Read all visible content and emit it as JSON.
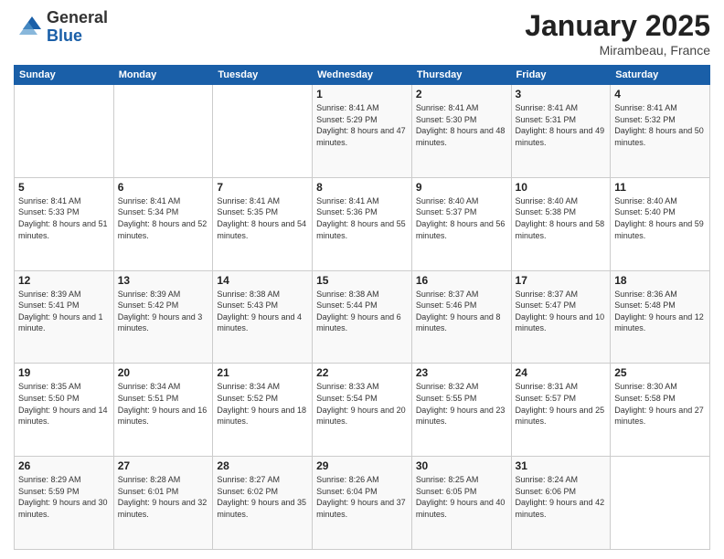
{
  "logo": {
    "general": "General",
    "blue": "Blue"
  },
  "header": {
    "month_year": "January 2025",
    "location": "Mirambeau, France"
  },
  "weekdays": [
    "Sunday",
    "Monday",
    "Tuesday",
    "Wednesday",
    "Thursday",
    "Friday",
    "Saturday"
  ],
  "weeks": [
    [
      {
        "day": "",
        "info": ""
      },
      {
        "day": "",
        "info": ""
      },
      {
        "day": "",
        "info": ""
      },
      {
        "day": "1",
        "info": "Sunrise: 8:41 AM\nSunset: 5:29 PM\nDaylight: 8 hours and 47 minutes."
      },
      {
        "day": "2",
        "info": "Sunrise: 8:41 AM\nSunset: 5:30 PM\nDaylight: 8 hours and 48 minutes."
      },
      {
        "day": "3",
        "info": "Sunrise: 8:41 AM\nSunset: 5:31 PM\nDaylight: 8 hours and 49 minutes."
      },
      {
        "day": "4",
        "info": "Sunrise: 8:41 AM\nSunset: 5:32 PM\nDaylight: 8 hours and 50 minutes."
      }
    ],
    [
      {
        "day": "5",
        "info": "Sunrise: 8:41 AM\nSunset: 5:33 PM\nDaylight: 8 hours and 51 minutes."
      },
      {
        "day": "6",
        "info": "Sunrise: 8:41 AM\nSunset: 5:34 PM\nDaylight: 8 hours and 52 minutes."
      },
      {
        "day": "7",
        "info": "Sunrise: 8:41 AM\nSunset: 5:35 PM\nDaylight: 8 hours and 54 minutes."
      },
      {
        "day": "8",
        "info": "Sunrise: 8:41 AM\nSunset: 5:36 PM\nDaylight: 8 hours and 55 minutes."
      },
      {
        "day": "9",
        "info": "Sunrise: 8:40 AM\nSunset: 5:37 PM\nDaylight: 8 hours and 56 minutes."
      },
      {
        "day": "10",
        "info": "Sunrise: 8:40 AM\nSunset: 5:38 PM\nDaylight: 8 hours and 58 minutes."
      },
      {
        "day": "11",
        "info": "Sunrise: 8:40 AM\nSunset: 5:40 PM\nDaylight: 8 hours and 59 minutes."
      }
    ],
    [
      {
        "day": "12",
        "info": "Sunrise: 8:39 AM\nSunset: 5:41 PM\nDaylight: 9 hours and 1 minute."
      },
      {
        "day": "13",
        "info": "Sunrise: 8:39 AM\nSunset: 5:42 PM\nDaylight: 9 hours and 3 minutes."
      },
      {
        "day": "14",
        "info": "Sunrise: 8:38 AM\nSunset: 5:43 PM\nDaylight: 9 hours and 4 minutes."
      },
      {
        "day": "15",
        "info": "Sunrise: 8:38 AM\nSunset: 5:44 PM\nDaylight: 9 hours and 6 minutes."
      },
      {
        "day": "16",
        "info": "Sunrise: 8:37 AM\nSunset: 5:46 PM\nDaylight: 9 hours and 8 minutes."
      },
      {
        "day": "17",
        "info": "Sunrise: 8:37 AM\nSunset: 5:47 PM\nDaylight: 9 hours and 10 minutes."
      },
      {
        "day": "18",
        "info": "Sunrise: 8:36 AM\nSunset: 5:48 PM\nDaylight: 9 hours and 12 minutes."
      }
    ],
    [
      {
        "day": "19",
        "info": "Sunrise: 8:35 AM\nSunset: 5:50 PM\nDaylight: 9 hours and 14 minutes."
      },
      {
        "day": "20",
        "info": "Sunrise: 8:34 AM\nSunset: 5:51 PM\nDaylight: 9 hours and 16 minutes."
      },
      {
        "day": "21",
        "info": "Sunrise: 8:34 AM\nSunset: 5:52 PM\nDaylight: 9 hours and 18 minutes."
      },
      {
        "day": "22",
        "info": "Sunrise: 8:33 AM\nSunset: 5:54 PM\nDaylight: 9 hours and 20 minutes."
      },
      {
        "day": "23",
        "info": "Sunrise: 8:32 AM\nSunset: 5:55 PM\nDaylight: 9 hours and 23 minutes."
      },
      {
        "day": "24",
        "info": "Sunrise: 8:31 AM\nSunset: 5:57 PM\nDaylight: 9 hours and 25 minutes."
      },
      {
        "day": "25",
        "info": "Sunrise: 8:30 AM\nSunset: 5:58 PM\nDaylight: 9 hours and 27 minutes."
      }
    ],
    [
      {
        "day": "26",
        "info": "Sunrise: 8:29 AM\nSunset: 5:59 PM\nDaylight: 9 hours and 30 minutes."
      },
      {
        "day": "27",
        "info": "Sunrise: 8:28 AM\nSunset: 6:01 PM\nDaylight: 9 hours and 32 minutes."
      },
      {
        "day": "28",
        "info": "Sunrise: 8:27 AM\nSunset: 6:02 PM\nDaylight: 9 hours and 35 minutes."
      },
      {
        "day": "29",
        "info": "Sunrise: 8:26 AM\nSunset: 6:04 PM\nDaylight: 9 hours and 37 minutes."
      },
      {
        "day": "30",
        "info": "Sunrise: 8:25 AM\nSunset: 6:05 PM\nDaylight: 9 hours and 40 minutes."
      },
      {
        "day": "31",
        "info": "Sunrise: 8:24 AM\nSunset: 6:06 PM\nDaylight: 9 hours and 42 minutes."
      },
      {
        "day": "",
        "info": ""
      }
    ]
  ]
}
